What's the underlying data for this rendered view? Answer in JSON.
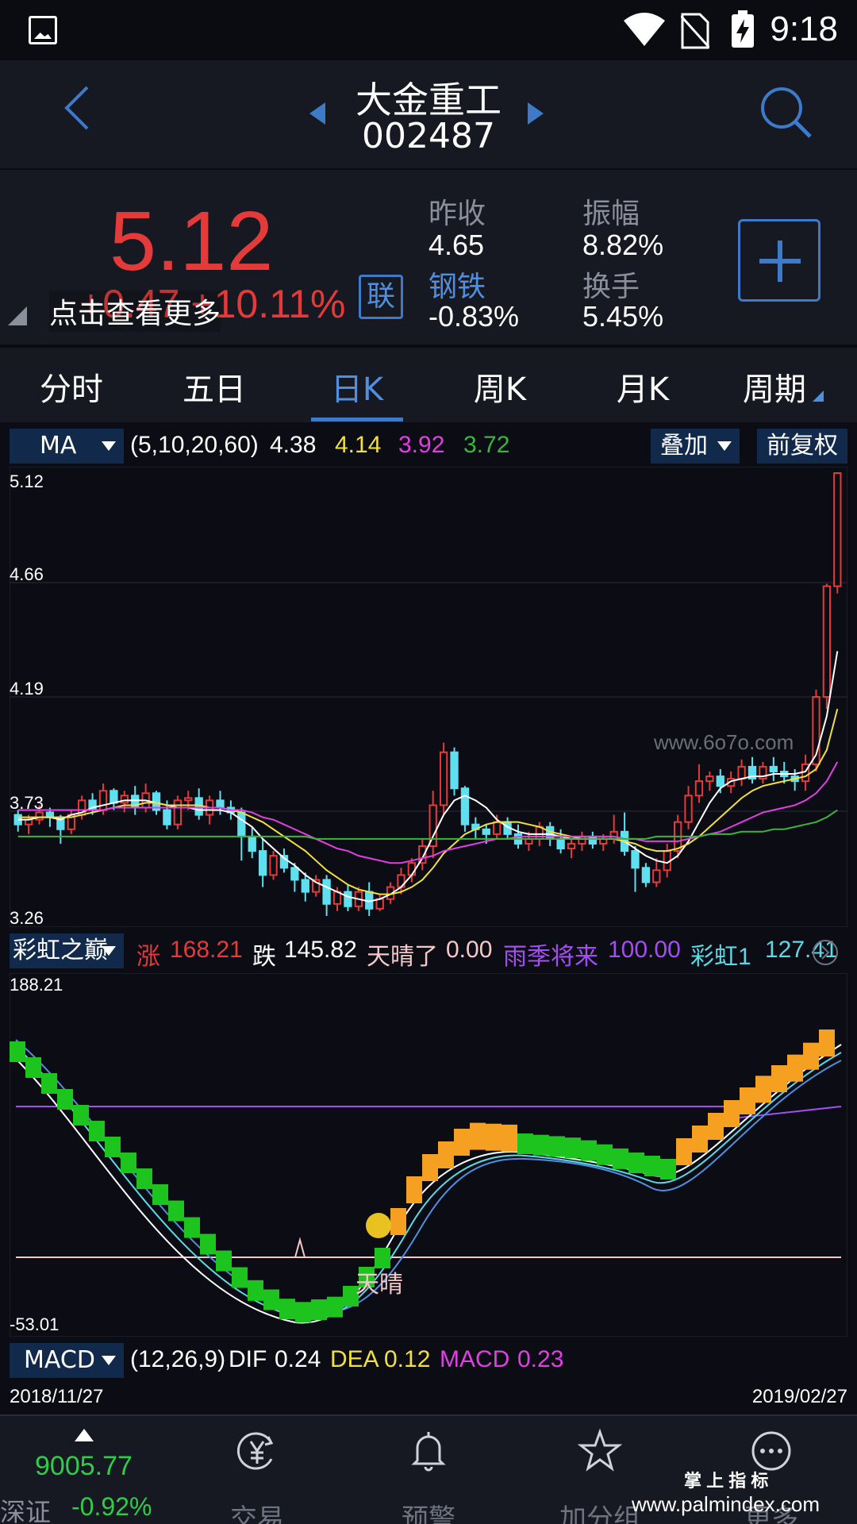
{
  "status_bar": {
    "time": "9:18"
  },
  "header": {
    "name": "大金重工",
    "code": "002487"
  },
  "quote": {
    "price": "5.12",
    "change": "+0.47  +10.11%",
    "more_tip": "点击查看更多",
    "lian_label": "联",
    "prev_close_label": "昨收",
    "prev_close_value": "4.65",
    "amplitude_label": "振幅",
    "amplitude_value": "8.82%",
    "sector_label": "钢铁",
    "sector_value": "-0.83%",
    "turnover_label": "换手",
    "turnover_value": "5.45%"
  },
  "tabs": [
    "分时",
    "五日",
    "日K",
    "周K",
    "月K",
    "周期"
  ],
  "active_tab": "日K",
  "ma_bar": {
    "indicator": "MA",
    "params": "(5,10,20,60)",
    "ma5": "4.38",
    "ma10": "4.14",
    "ma20": "3.92",
    "ma60": "3.72",
    "overlay_label": "叠加",
    "adjust_label": "前复权",
    "colors": {
      "ma5": "#ffffff",
      "ma10": "#f0e040",
      "ma20": "#e040e0",
      "ma60": "#3cb43c"
    }
  },
  "price_axis": [
    "5.12",
    "4.66",
    "4.19",
    "3.73",
    "3.26"
  ],
  "watermark_chart": "www.6o7o.com",
  "indicator_bar": {
    "name": "彩虹之巅",
    "zhang_label": "涨",
    "zhang_value": "168.21",
    "die_label": "跌",
    "die_value": "145.82",
    "tianqing_label": "天晴了",
    "tianqing_value": "0.00",
    "yuji_label": "雨季将来",
    "yuji_value": "100.00",
    "caihong_label": "彩虹1",
    "caihong_value": "127.41"
  },
  "indicator_axis": [
    "188.21",
    "-53.01"
  ],
  "signal_label": "天晴",
  "macd_bar": {
    "name": "MACD",
    "params": "(12,26,9)",
    "dif_label": "DIF",
    "dif_value": "0.24",
    "dea_label": "DEA",
    "dea_value": "0.12",
    "macd_label": "MACD",
    "macd_value": "0.23"
  },
  "dates": {
    "start": "2018/11/27",
    "end": "2019/02/27"
  },
  "navbar": {
    "index_value": "9005.77",
    "index_name": "深证",
    "index_change": "-0.92%",
    "items": [
      {
        "label": "交易",
        "icon": "yuan-icon"
      },
      {
        "label": "预警",
        "icon": "bell-icon"
      },
      {
        "label": "加分组",
        "icon": "star-icon"
      },
      {
        "label": "更多",
        "icon": "more-icon"
      }
    ],
    "watermark_top": "掌 上 指 标",
    "watermark_url": "www.palmindex.com"
  },
  "chart_data": {
    "type": "candlestick",
    "ylim": [
      3.26,
      5.12
    ],
    "candles": [
      [
        3.7,
        3.66,
        3.72,
        3.63
      ],
      [
        3.66,
        3.68,
        3.7,
        3.62
      ],
      [
        3.68,
        3.71,
        3.74,
        3.66
      ],
      [
        3.71,
        3.69,
        3.73,
        3.65
      ],
      [
        3.69,
        3.64,
        3.7,
        3.58
      ],
      [
        3.64,
        3.7,
        3.72,
        3.62
      ],
      [
        3.7,
        3.76,
        3.78,
        3.68
      ],
      [
        3.76,
        3.72,
        3.79,
        3.7
      ],
      [
        3.72,
        3.8,
        3.83,
        3.7
      ],
      [
        3.8,
        3.75,
        3.81,
        3.72
      ],
      [
        3.75,
        3.78,
        3.8,
        3.71
      ],
      [
        3.78,
        3.73,
        3.82,
        3.7
      ],
      [
        3.73,
        3.79,
        3.83,
        3.71
      ],
      [
        3.79,
        3.72,
        3.8,
        3.7
      ],
      [
        3.72,
        3.66,
        3.76,
        3.64
      ],
      [
        3.66,
        3.76,
        3.78,
        3.64
      ],
      [
        3.76,
        3.77,
        3.8,
        3.72
      ],
      [
        3.77,
        3.7,
        3.81,
        3.68
      ],
      [
        3.7,
        3.76,
        3.78,
        3.66
      ],
      [
        3.76,
        3.73,
        3.8,
        3.7
      ],
      [
        3.73,
        3.71,
        3.76,
        3.68
      ],
      [
        3.71,
        3.61,
        3.73,
        3.51
      ],
      [
        3.61,
        3.55,
        3.65,
        3.52
      ],
      [
        3.55,
        3.45,
        3.6,
        3.4
      ],
      [
        3.45,
        3.53,
        3.55,
        3.43
      ],
      [
        3.53,
        3.48,
        3.56,
        3.46
      ],
      [
        3.48,
        3.43,
        3.5,
        3.38
      ],
      [
        3.43,
        3.38,
        3.46,
        3.34
      ],
      [
        3.38,
        3.43,
        3.45,
        3.36
      ],
      [
        3.43,
        3.33,
        3.45,
        3.28
      ],
      [
        3.33,
        3.38,
        3.4,
        3.3
      ],
      [
        3.38,
        3.32,
        3.41,
        3.3
      ],
      [
        3.32,
        3.38,
        3.4,
        3.3
      ],
      [
        3.38,
        3.31,
        3.42,
        3.28
      ],
      [
        3.31,
        3.35,
        3.37,
        3.3
      ],
      [
        3.35,
        3.4,
        3.42,
        3.33
      ],
      [
        3.4,
        3.45,
        3.48,
        3.37
      ],
      [
        3.45,
        3.5,
        3.52,
        3.42
      ],
      [
        3.5,
        3.57,
        3.6,
        3.47
      ],
      [
        3.57,
        3.74,
        3.8,
        3.52
      ],
      [
        3.74,
        3.96,
        4.0,
        3.7
      ],
      [
        3.96,
        3.81,
        3.98,
        3.78
      ],
      [
        3.81,
        3.66,
        3.82,
        3.63
      ],
      [
        3.66,
        3.64,
        3.69,
        3.6
      ],
      [
        3.64,
        3.62,
        3.66,
        3.58
      ],
      [
        3.62,
        3.67,
        3.7,
        3.6
      ],
      [
        3.67,
        3.62,
        3.69,
        3.6
      ],
      [
        3.62,
        3.58,
        3.66,
        3.56
      ],
      [
        3.58,
        3.6,
        3.63,
        3.55
      ],
      [
        3.6,
        3.65,
        3.67,
        3.57
      ],
      [
        3.65,
        3.6,
        3.67,
        3.57
      ],
      [
        3.6,
        3.56,
        3.64,
        3.54
      ],
      [
        3.56,
        3.58,
        3.6,
        3.52
      ],
      [
        3.58,
        3.61,
        3.63,
        3.55
      ],
      [
        3.61,
        3.58,
        3.63,
        3.56
      ],
      [
        3.58,
        3.6,
        3.62,
        3.55
      ],
      [
        3.6,
        3.63,
        3.7,
        3.58
      ],
      [
        3.63,
        3.55,
        3.71,
        3.53
      ],
      [
        3.55,
        3.48,
        3.57,
        3.38
      ],
      [
        3.48,
        3.42,
        3.5,
        3.4
      ],
      [
        3.42,
        3.47,
        3.52,
        3.4
      ],
      [
        3.47,
        3.55,
        3.58,
        3.44
      ],
      [
        3.55,
        3.67,
        3.7,
        3.52
      ],
      [
        3.67,
        3.78,
        3.82,
        3.64
      ],
      [
        3.78,
        3.84,
        3.91,
        3.75
      ],
      [
        3.84,
        3.86,
        3.88,
        3.8
      ],
      [
        3.86,
        3.82,
        3.89,
        3.79
      ],
      [
        3.82,
        3.85,
        3.88,
        3.79
      ],
      [
        3.85,
        3.9,
        3.93,
        3.82
      ],
      [
        3.9,
        3.85,
        3.94,
        3.83
      ],
      [
        3.85,
        3.9,
        3.92,
        3.83
      ],
      [
        3.9,
        3.88,
        3.94,
        3.84
      ],
      [
        3.88,
        3.86,
        3.92,
        3.83
      ],
      [
        3.86,
        3.84,
        3.89,
        3.8
      ],
      [
        3.84,
        3.91,
        3.95,
        3.8
      ],
      [
        3.91,
        4.19,
        4.22,
        3.88
      ],
      [
        4.19,
        4.65,
        4.66,
        4.14
      ],
      [
        4.65,
        5.12,
        5.12,
        4.62
      ]
    ],
    "ma": {
      "ma5": [
        3.68,
        3.68,
        3.69,
        3.69,
        3.68,
        3.7,
        3.71,
        3.73,
        3.74,
        3.75,
        3.76,
        3.76,
        3.76,
        3.75,
        3.74,
        3.73,
        3.73,
        3.72,
        3.72,
        3.72,
        3.71,
        3.68,
        3.65,
        3.6,
        3.56,
        3.52,
        3.49,
        3.45,
        3.42,
        3.4,
        3.38,
        3.36,
        3.35,
        3.34,
        3.35,
        3.37,
        3.4,
        3.45,
        3.52,
        3.61,
        3.7,
        3.76,
        3.78,
        3.76,
        3.73,
        3.68,
        3.65,
        3.63,
        3.62,
        3.62,
        3.62,
        3.61,
        3.6,
        3.6,
        3.6,
        3.6,
        3.6,
        3.59,
        3.56,
        3.53,
        3.51,
        3.5,
        3.53,
        3.59,
        3.67,
        3.75,
        3.81,
        3.84,
        3.85,
        3.86,
        3.86,
        3.87,
        3.87,
        3.87,
        3.88,
        3.95,
        4.11,
        4.38
      ],
      "ma10": [
        3.69,
        3.69,
        3.69,
        3.69,
        3.69,
        3.69,
        3.7,
        3.71,
        3.72,
        3.73,
        3.74,
        3.74,
        3.75,
        3.75,
        3.74,
        3.74,
        3.74,
        3.74,
        3.73,
        3.73,
        3.72,
        3.71,
        3.69,
        3.67,
        3.64,
        3.61,
        3.58,
        3.55,
        3.51,
        3.47,
        3.44,
        3.41,
        3.39,
        3.38,
        3.37,
        3.37,
        3.38,
        3.4,
        3.43,
        3.48,
        3.54,
        3.58,
        3.62,
        3.64,
        3.66,
        3.67,
        3.67,
        3.67,
        3.66,
        3.65,
        3.63,
        3.62,
        3.61,
        3.6,
        3.6,
        3.6,
        3.6,
        3.59,
        3.58,
        3.56,
        3.55,
        3.55,
        3.56,
        3.58,
        3.61,
        3.65,
        3.69,
        3.73,
        3.77,
        3.8,
        3.82,
        3.83,
        3.84,
        3.85,
        3.86,
        3.89,
        3.97,
        4.14
      ],
      "ma20": [
        3.72,
        3.72,
        3.72,
        3.72,
        3.72,
        3.72,
        3.72,
        3.72,
        3.72,
        3.73,
        3.73,
        3.73,
        3.73,
        3.73,
        3.73,
        3.73,
        3.73,
        3.73,
        3.73,
        3.73,
        3.72,
        3.72,
        3.71,
        3.69,
        3.68,
        3.66,
        3.64,
        3.62,
        3.6,
        3.58,
        3.56,
        3.55,
        3.53,
        3.52,
        3.51,
        3.5,
        3.5,
        3.51,
        3.52,
        3.53,
        3.55,
        3.56,
        3.57,
        3.58,
        3.59,
        3.6,
        3.6,
        3.61,
        3.61,
        3.61,
        3.61,
        3.61,
        3.61,
        3.61,
        3.61,
        3.61,
        3.61,
        3.6,
        3.6,
        3.59,
        3.59,
        3.59,
        3.59,
        3.6,
        3.61,
        3.62,
        3.63,
        3.65,
        3.67,
        3.69,
        3.71,
        3.72,
        3.73,
        3.74,
        3.76,
        3.79,
        3.84,
        3.92
      ],
      "ma60": [
        3.61,
        3.61,
        3.61,
        3.61,
        3.61,
        3.61,
        3.61,
        3.61,
        3.61,
        3.61,
        3.61,
        3.61,
        3.61,
        3.61,
        3.61,
        3.61,
        3.61,
        3.61,
        3.61,
        3.61,
        3.61,
        3.61,
        3.61,
        3.61,
        3.61,
        3.61,
        3.61,
        3.61,
        3.6,
        3.6,
        3.6,
        3.6,
        3.6,
        3.6,
        3.6,
        3.6,
        3.6,
        3.6,
        3.6,
        3.6,
        3.6,
        3.6,
        3.6,
        3.6,
        3.6,
        3.6,
        3.6,
        3.6,
        3.6,
        3.6,
        3.6,
        3.6,
        3.6,
        3.6,
        3.6,
        3.6,
        3.6,
        3.6,
        3.6,
        3.6,
        3.61,
        3.61,
        3.61,
        3.61,
        3.61,
        3.62,
        3.62,
        3.62,
        3.63,
        3.63,
        3.63,
        3.64,
        3.64,
        3.65,
        3.66,
        3.67,
        3.69,
        3.72
      ]
    }
  }
}
